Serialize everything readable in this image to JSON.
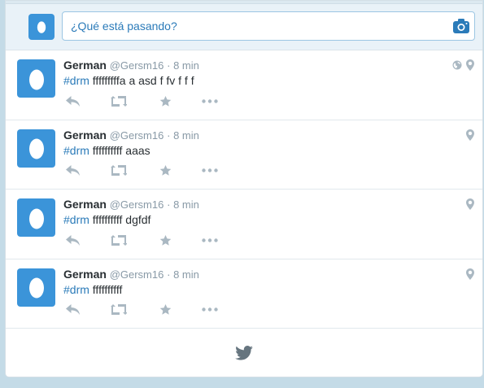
{
  "compose": {
    "placeholder": "¿Qué está pasando?"
  },
  "tweets": [
    {
      "fullname": "German",
      "username": "@Gersm16",
      "time": "· 8 min",
      "hashtag": "#drm",
      "text": " fffffffffa a asd f fv f f f",
      "globe": true
    },
    {
      "fullname": "German",
      "username": "@Gersm16",
      "time": "· 8 min",
      "hashtag": "#drm",
      "text": " ffffffffff aaas",
      "globe": false
    },
    {
      "fullname": "German",
      "username": "@Gersm16",
      "time": "· 8 min",
      "hashtag": "#drm",
      "text": " ffffffffff dgfdf",
      "globe": false
    },
    {
      "fullname": "German",
      "username": "@Gersm16",
      "time": "· 8 min",
      "hashtag": "#drm",
      "text": " ffffffffff",
      "globe": false
    }
  ],
  "icons": {
    "reply": "reply-icon",
    "retweet": "retweet-icon",
    "favorite": "star-icon",
    "more": "more-icon",
    "location": "pin-icon",
    "globe": "globe-icon",
    "camera": "camera-icon",
    "brand": "twitter-bird-icon"
  },
  "colors": {
    "accent": "#2b7bb9",
    "avatar": "#3b94d9",
    "action_gray": "#aab8c2"
  }
}
